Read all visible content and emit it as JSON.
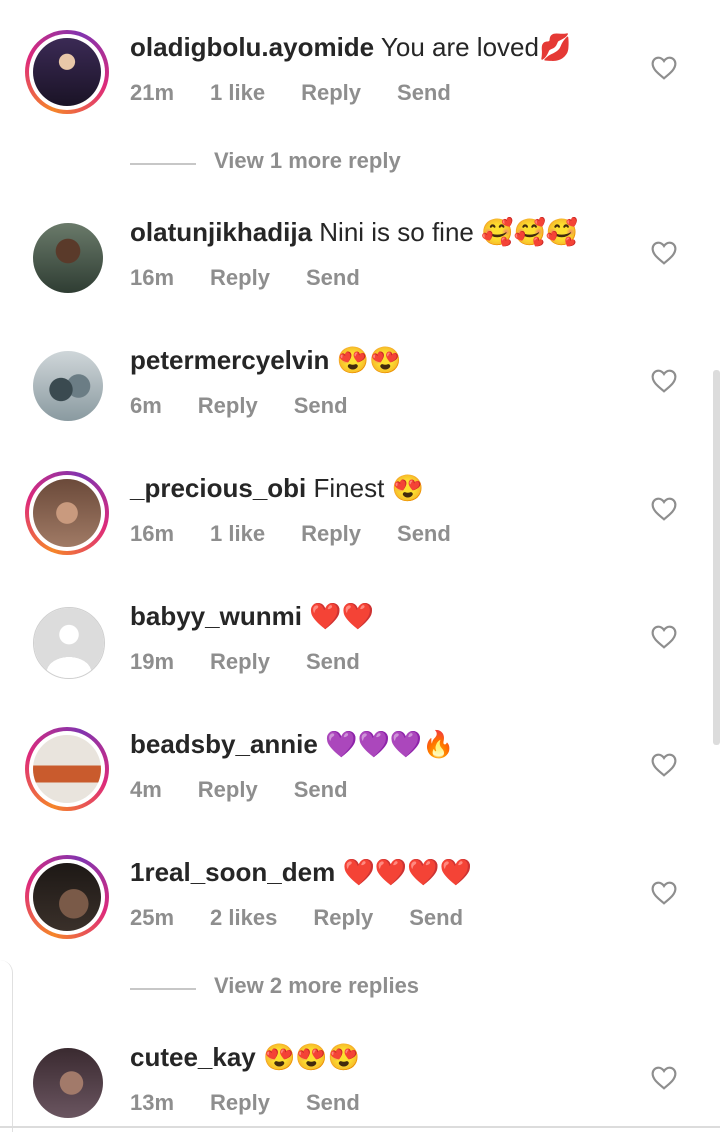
{
  "comments": [
    {
      "username": "oladigbolu.ayomide",
      "text": "You are loved",
      "emoji": "💋",
      "time": "21m",
      "likes": "1 like",
      "reply": "Reply",
      "send": "Send",
      "story_ring": true,
      "avatar_color": "#2a1a3d"
    },
    {
      "username": "olatunjikhadija",
      "text": "Nini is so fine",
      "emoji": "🥰🥰🥰",
      "time": "16m",
      "likes": "",
      "reply": "Reply",
      "send": "Send",
      "story_ring": false,
      "avatar_color": "#3a4a3a"
    },
    {
      "username": "petermercyelvin",
      "text": "",
      "emoji": "😍😍",
      "time": "6m",
      "likes": "",
      "reply": "Reply",
      "send": "Send",
      "story_ring": false,
      "avatar_color": "#7a8a90"
    },
    {
      "username": "_precious_obi",
      "text": "Finest",
      "emoji": "😍",
      "time": "16m",
      "likes": "1 like",
      "reply": "Reply",
      "send": "Send",
      "story_ring": true,
      "avatar_color": "#c8a088"
    },
    {
      "username": "babyy_wunmi",
      "text": "",
      "emoji": "❤️❤️",
      "time": "19m",
      "likes": "",
      "reply": "Reply",
      "send": "Send",
      "story_ring": false,
      "avatar_color": "#dcdcdc"
    },
    {
      "username": "beadsby_annie",
      "text": "",
      "emoji": "💜💜💜🔥",
      "time": "4m",
      "likes": "",
      "reply": "Reply",
      "send": "Send",
      "story_ring": true,
      "avatar_color": "#d9cfc4"
    },
    {
      "username": "1real_soon_dem",
      "text": "",
      "emoji": "❤️❤️❤️❤️",
      "time": "25m",
      "likes": "2 likes",
      "reply": "Reply",
      "send": "Send",
      "story_ring": true,
      "avatar_color": "#2b2522"
    },
    {
      "username": "cutee_kay",
      "text": "",
      "emoji": "😍😍😍",
      "time": "13m",
      "likes": "",
      "reply": "Reply",
      "send": "Send",
      "story_ring": false,
      "avatar_color": "#4a3a40"
    }
  ],
  "view_more": [
    {
      "label": "View 1 more reply"
    },
    {
      "label": "View 2 more replies"
    }
  ],
  "colors": {
    "secondary_text": "#8e8e8e",
    "primary_text": "#262626",
    "heart_outline": "#8e8e8e"
  }
}
